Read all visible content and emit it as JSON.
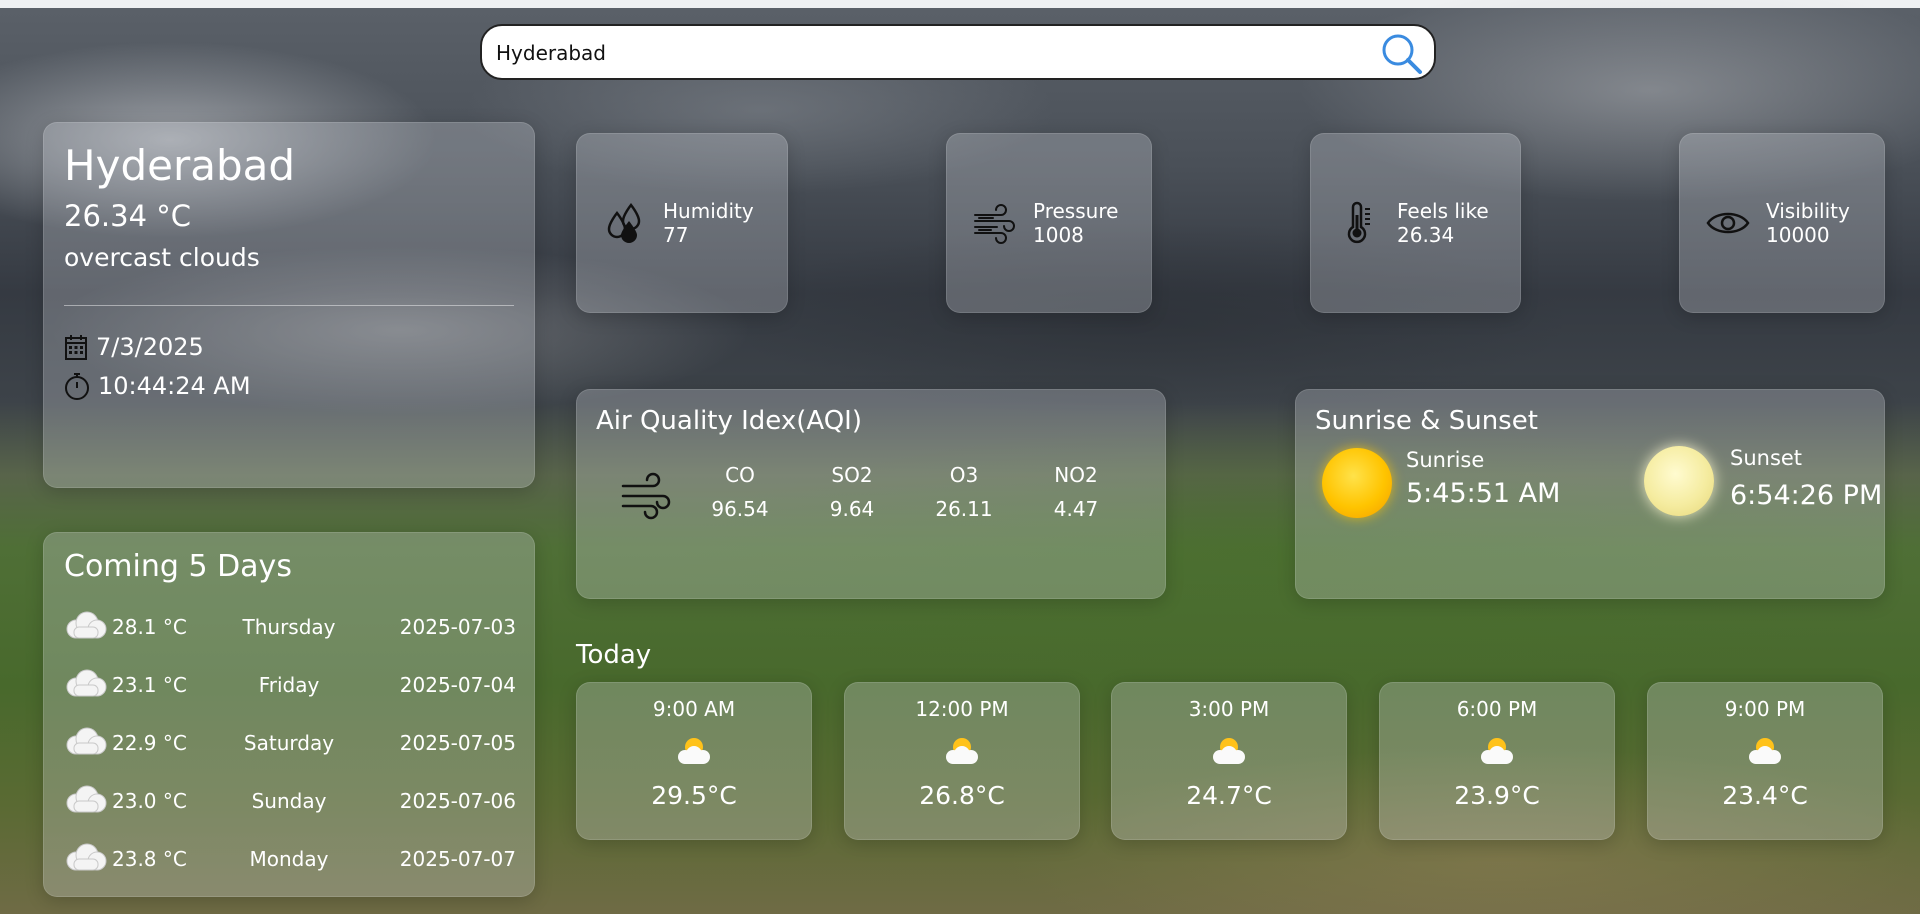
{
  "search": {
    "value": "Hyderabad"
  },
  "current": {
    "city": "Hyderabad",
    "temp": "26.34 °C",
    "description": "overcast clouds",
    "date": "7/3/2025",
    "time": "10:44:24 AM"
  },
  "forecast": {
    "title": "Coming 5 Days",
    "days": [
      {
        "temp": "28.1 °C",
        "day": "Thursday",
        "date": "2025-07-03"
      },
      {
        "temp": "23.1 °C",
        "day": "Friday",
        "date": "2025-07-04"
      },
      {
        "temp": "22.9 °C",
        "day": "Saturday",
        "date": "2025-07-05"
      },
      {
        "temp": "23.0 °C",
        "day": "Sunday",
        "date": "2025-07-06"
      },
      {
        "temp": "23.8 °C",
        "day": "Monday",
        "date": "2025-07-07"
      }
    ]
  },
  "stats": [
    {
      "label": "Humidity",
      "value": "77",
      "icon": "humidity-icon"
    },
    {
      "label": "Pressure",
      "value": "1008",
      "icon": "wind-icon"
    },
    {
      "label": "Feels like",
      "value": "26.34",
      "icon": "thermometer-icon"
    },
    {
      "label": "Visibility",
      "value": "10000",
      "icon": "eye-icon"
    }
  ],
  "aqi": {
    "title": "Air Quality Idex(AQI)",
    "items": [
      {
        "label": "CO",
        "value": "96.54"
      },
      {
        "label": "SO2",
        "value": "9.64"
      },
      {
        "label": "O3",
        "value": "26.11"
      },
      {
        "label": "NO2",
        "value": "4.47"
      }
    ]
  },
  "sun": {
    "title": "Sunrise & Sunset",
    "sunrise_label": "Sunrise",
    "sunrise_time": "5:45:51 AM",
    "sunset_label": "Sunset",
    "sunset_time": "6:54:26 PM"
  },
  "today": {
    "title": "Today",
    "hours": [
      {
        "time": "9:00 AM",
        "temp": "29.5°C"
      },
      {
        "time": "12:00 PM",
        "temp": "26.8°C"
      },
      {
        "time": "3:00 PM",
        "temp": "24.7°C"
      },
      {
        "time": "6:00 PM",
        "temp": "23.9°C"
      },
      {
        "time": "9:00 PM",
        "temp": "23.4°C"
      }
    ]
  }
}
